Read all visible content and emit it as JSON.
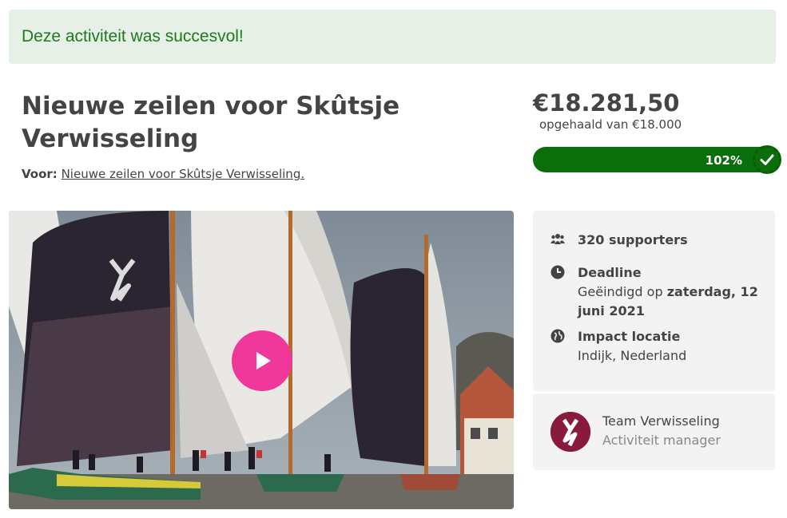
{
  "banner": {
    "message": "Deze activiteit was succesvol!"
  },
  "project": {
    "title": "Nieuwe zeilen voor Skûtsje Verwisseling",
    "for_label": "Voor:",
    "for_link": "Nieuwe zeilen voor Skûtsje Verwisseling."
  },
  "funding": {
    "raised": "€18.281,50",
    "goal_text": "opgehaald van €18.000",
    "percent_label": "102%",
    "percent": 102
  },
  "info": {
    "supporters": "320 supporters",
    "deadline_label": "Deadline",
    "deadline_text_1": "Geëindigd op ",
    "deadline_date_1": "zaterdag, 12",
    "deadline_date_2": "juni 2021",
    "location_label": "Impact locatie",
    "location_value": "Indijk, Nederland"
  },
  "manager": {
    "name": "Team Verwisseling",
    "role": "Activiteit manager"
  },
  "colors": {
    "accent_green": "#0a6e0a",
    "banner_bg": "#e7f0e7",
    "banner_text": "#1e7a1e",
    "play_pink": "#f0389a",
    "manager_brand": "#8a1a3c"
  }
}
